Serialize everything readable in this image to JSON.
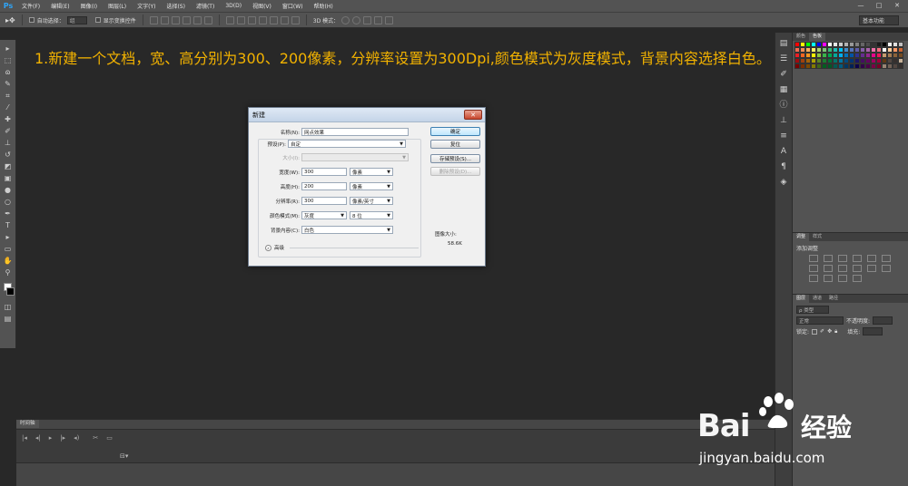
{
  "app": {
    "logo": "Ps",
    "menus": [
      "文件(F)",
      "编辑(E)",
      "图像(I)",
      "图层(L)",
      "文字(Y)",
      "选择(S)",
      "滤镜(T)",
      "3D(D)",
      "视图(V)",
      "窗口(W)",
      "帮助(H)"
    ],
    "window_buttons": [
      "—",
      "□",
      "✕"
    ]
  },
  "options": {
    "auto_select_label": "自动选择：",
    "auto_select_value": "组",
    "show_transform_label": "显示变换控件",
    "mode_3d_label": "3D 模式：",
    "workspace": "基本功能"
  },
  "instruction": {
    "text": "1.新建一个文档，宽、高分别为300、200像素，分辨率设置为300Dpi,颜色模式为灰度模式，背景内容选择白色。"
  },
  "dialog": {
    "title": "新建",
    "close": "✕",
    "name_label": "名称(N):",
    "name_value": "网点效果",
    "preset_label": "预设(P):",
    "preset_value": "自定",
    "size_label": "大小(I):",
    "size_value": "",
    "width_label": "宽度(W):",
    "width_value": "300",
    "width_unit": "像素",
    "height_label": "高度(H):",
    "height_value": "200",
    "height_unit": "像素",
    "resolution_label": "分辨率(R):",
    "resolution_value": "300",
    "resolution_unit": "像素/英寸",
    "color_mode_label": "颜色模式(M):",
    "color_mode_value": "灰度",
    "bit_depth_value": "8 位",
    "bg_label": "背景内容(C):",
    "bg_value": "白色",
    "advanced_label": "高级",
    "ok_button": "确定",
    "reset_button": "复位",
    "save_preset_button": "存储预设(S)...",
    "delete_preset_button": "删除预设(D)...",
    "image_size_label": "图像大小:",
    "image_size_value": "58.6K"
  },
  "panels": {
    "swatch_tabs": [
      "颜色",
      "色板"
    ],
    "adjust_tabs": [
      "调整",
      "样式"
    ],
    "adjust_label": "添加调整",
    "layer_tabs": [
      "图层",
      "通道",
      "路径"
    ],
    "layer_kind": "ρ 类型",
    "blend_mode": "正常",
    "opacity_label": "不透明度:",
    "lock_label": "锁定:",
    "fill_label": "填充:"
  },
  "timeline": {
    "tab": "时间轴"
  },
  "watermark": {
    "brand": "Bai",
    "brand_cn": "经验",
    "url": "jingyan.baidu.com"
  },
  "colors": {
    "instruction": "#f2b200",
    "canvas": "#282828"
  }
}
